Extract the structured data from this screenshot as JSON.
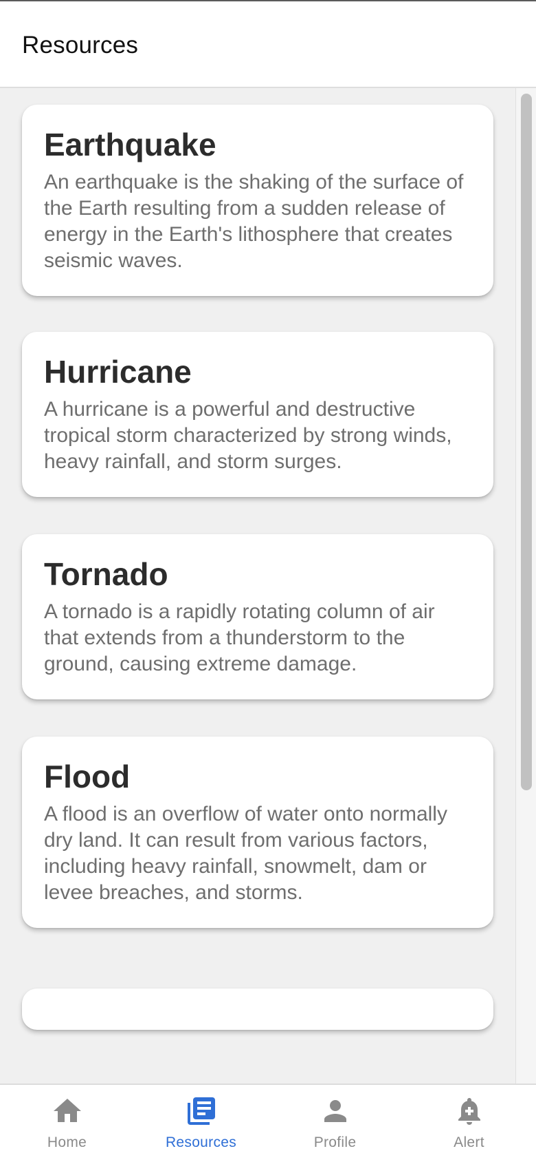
{
  "header": {
    "title": "Resources"
  },
  "cards": [
    {
      "title": "Earthquake",
      "description": "An earthquake is the shaking of the surface of the Earth resulting from a sudden release of energy in the Earth's lithosphere that creates seismic waves."
    },
    {
      "title": "Hurricane",
      "description": "A hurricane is a powerful and destructive tropical storm characterized by strong winds, heavy rainfall, and storm surges."
    },
    {
      "title": "Tornado",
      "description": "A tornado is a rapidly rotating column of air that extends from a thunderstorm to the ground, causing extreme damage."
    },
    {
      "title": "Flood",
      "description": "A flood is an overflow of water onto normally dry land. It can result from various factors, including heavy rainfall, snowmelt, dam or levee breaches, and storms."
    }
  ],
  "tabbar": {
    "items": [
      {
        "label": "Home",
        "icon": "home-icon",
        "active": false
      },
      {
        "label": "Resources",
        "icon": "newspaper-icon",
        "active": true
      },
      {
        "label": "Profile",
        "icon": "person-icon",
        "active": false
      },
      {
        "label": "Alert",
        "icon": "bell-plus-icon",
        "active": false
      }
    ]
  },
  "colors": {
    "active_tab": "#2f6fd6",
    "inactive_tab": "#8a8a8a",
    "background": "#f0f0f0",
    "card": "#ffffff"
  }
}
